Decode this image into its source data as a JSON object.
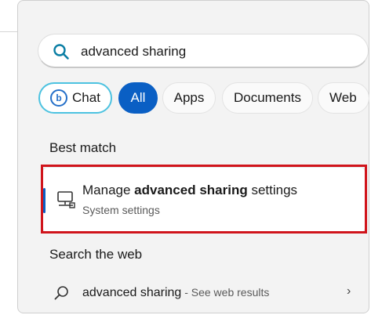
{
  "search": {
    "query": "advanced sharing",
    "icon": "search-icon"
  },
  "filters": [
    {
      "label": "Chat",
      "active": false
    },
    {
      "label": "All",
      "active": true
    },
    {
      "label": "Apps",
      "active": false
    },
    {
      "label": "Documents",
      "active": false
    },
    {
      "label": "Web",
      "active": false
    }
  ],
  "best_match": {
    "section_title": "Best match",
    "title_prefix": "Manage ",
    "title_bold": "advanced sharing",
    "title_suffix": " settings",
    "subtitle": "System settings",
    "icon": "network-computer-icon"
  },
  "web": {
    "section_title": "Search the web",
    "query": "advanced sharing",
    "suffix": " - See web results",
    "chevron": "›"
  },
  "colors": {
    "accent": "#0a5fc4",
    "highlight": "#d0141b",
    "chat_ring": "#4cc2e0"
  }
}
